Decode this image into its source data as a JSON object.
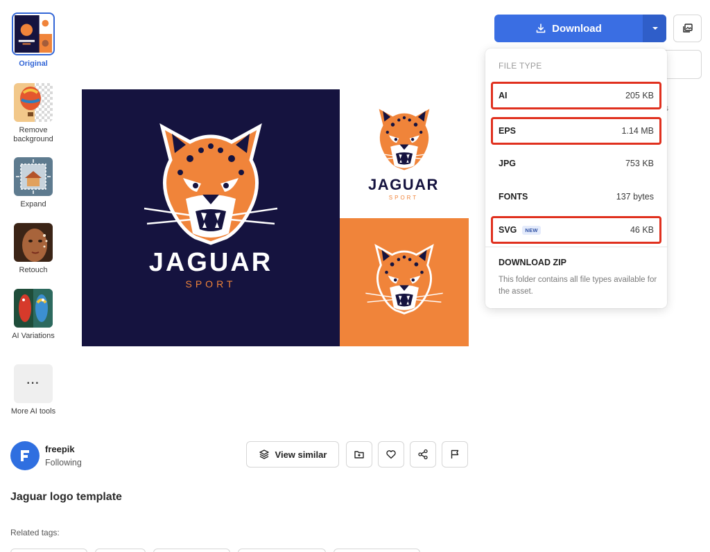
{
  "tools": [
    {
      "label": "Original",
      "icon": "jaguar-logo-thumbnail",
      "active": true
    },
    {
      "label": "Remove background",
      "icon": "hot-air-balloon-thumbnail"
    },
    {
      "label": "Expand",
      "icon": "expand-house-thumbnail"
    },
    {
      "label": "Retouch",
      "icon": "retouch-face-thumbnail"
    },
    {
      "label": "AI Variations",
      "icon": "parrots-thumbnail"
    },
    {
      "label": "More AI tools",
      "icon": "more-icon",
      "glyph": "···"
    }
  ],
  "preview": {
    "brand_main": "JAGUAR",
    "brand_sub": "SPORT",
    "colors": {
      "navy": "#15133f",
      "orange": "#f0843a",
      "white": "#ffffff"
    }
  },
  "author": {
    "name": "freepik",
    "status": "Following",
    "avatar_color": "#2f6fe0"
  },
  "actions": {
    "view_similar": "View similar"
  },
  "asset_title": "Jaguar logo template",
  "related_tags_label": "Related tags:",
  "download": {
    "button_label": "Download",
    "button_color": "#3a6ee3",
    "menu": {
      "header": "FILE TYPE",
      "items": [
        {
          "name": "AI",
          "size": "205 KB",
          "highlighted": true
        },
        {
          "name": "EPS",
          "size": "1.14 MB",
          "highlighted": true
        },
        {
          "name": "JPG",
          "size": "753 KB",
          "highlighted": false
        },
        {
          "name": "FONTS",
          "size": "137 bytes",
          "highlighted": false
        },
        {
          "name": "SVG",
          "size": "46 KB",
          "highlighted": true,
          "badge": "NEW"
        }
      ],
      "zip_title": "DOWNLOAD ZIP",
      "zip_desc": "This folder contains all file types available for the asset."
    },
    "highlight_color": "#e0301e"
  },
  "partial_glyph": "s"
}
